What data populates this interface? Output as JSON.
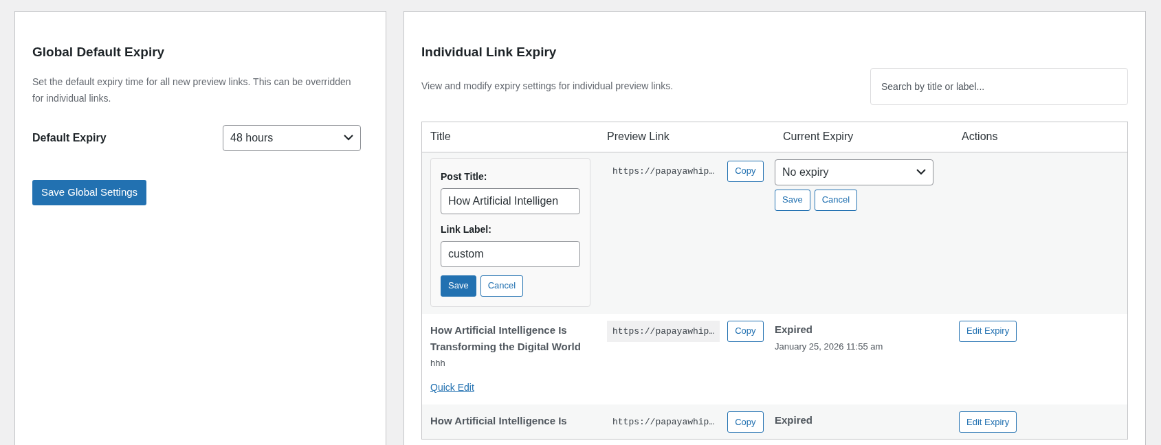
{
  "global_panel": {
    "title": "Global Default Expiry",
    "description": "Set the default expiry time for all new preview links. This can be overridden for individual links.",
    "field_label": "Default Expiry",
    "select_value": "48 hours",
    "save_button": "Save Global Settings"
  },
  "individual_panel": {
    "title": "Individual Link Expiry",
    "description": "View and modify expiry settings for individual preview links.",
    "search": {
      "placeholder": "Search by title or label..."
    },
    "table": {
      "columns": [
        "Title",
        "Preview Link",
        "Current Expiry",
        "Actions"
      ],
      "rows": [
        {
          "kind": "edit",
          "post_title_label": "Post Title:",
          "post_title_value": "How Artificial Intelligen",
          "link_label_label": "Link Label:",
          "link_label_value": "custom",
          "save": "Save",
          "cancel": "Cancel",
          "link": "https://papayawhip…",
          "copy": "Copy",
          "expiry_select": "No expiry",
          "expiry_save": "Save",
          "expiry_cancel": "Cancel"
        },
        {
          "kind": "view",
          "title": "How Artificial Intelligence Is Transforming the Digital World",
          "label": "hhh",
          "quick_edit": "Quick Edit",
          "link": "https://papayawhip…",
          "copy": "Copy",
          "status": "Expired",
          "date": "January 25, 2026 11:55 am",
          "action": "Edit Expiry"
        },
        {
          "kind": "view",
          "title": "How Artificial Intelligence Is",
          "link": "https://papayawhip…",
          "copy": "Copy",
          "status": "Expired",
          "action": "Edit Expiry"
        }
      ]
    }
  }
}
